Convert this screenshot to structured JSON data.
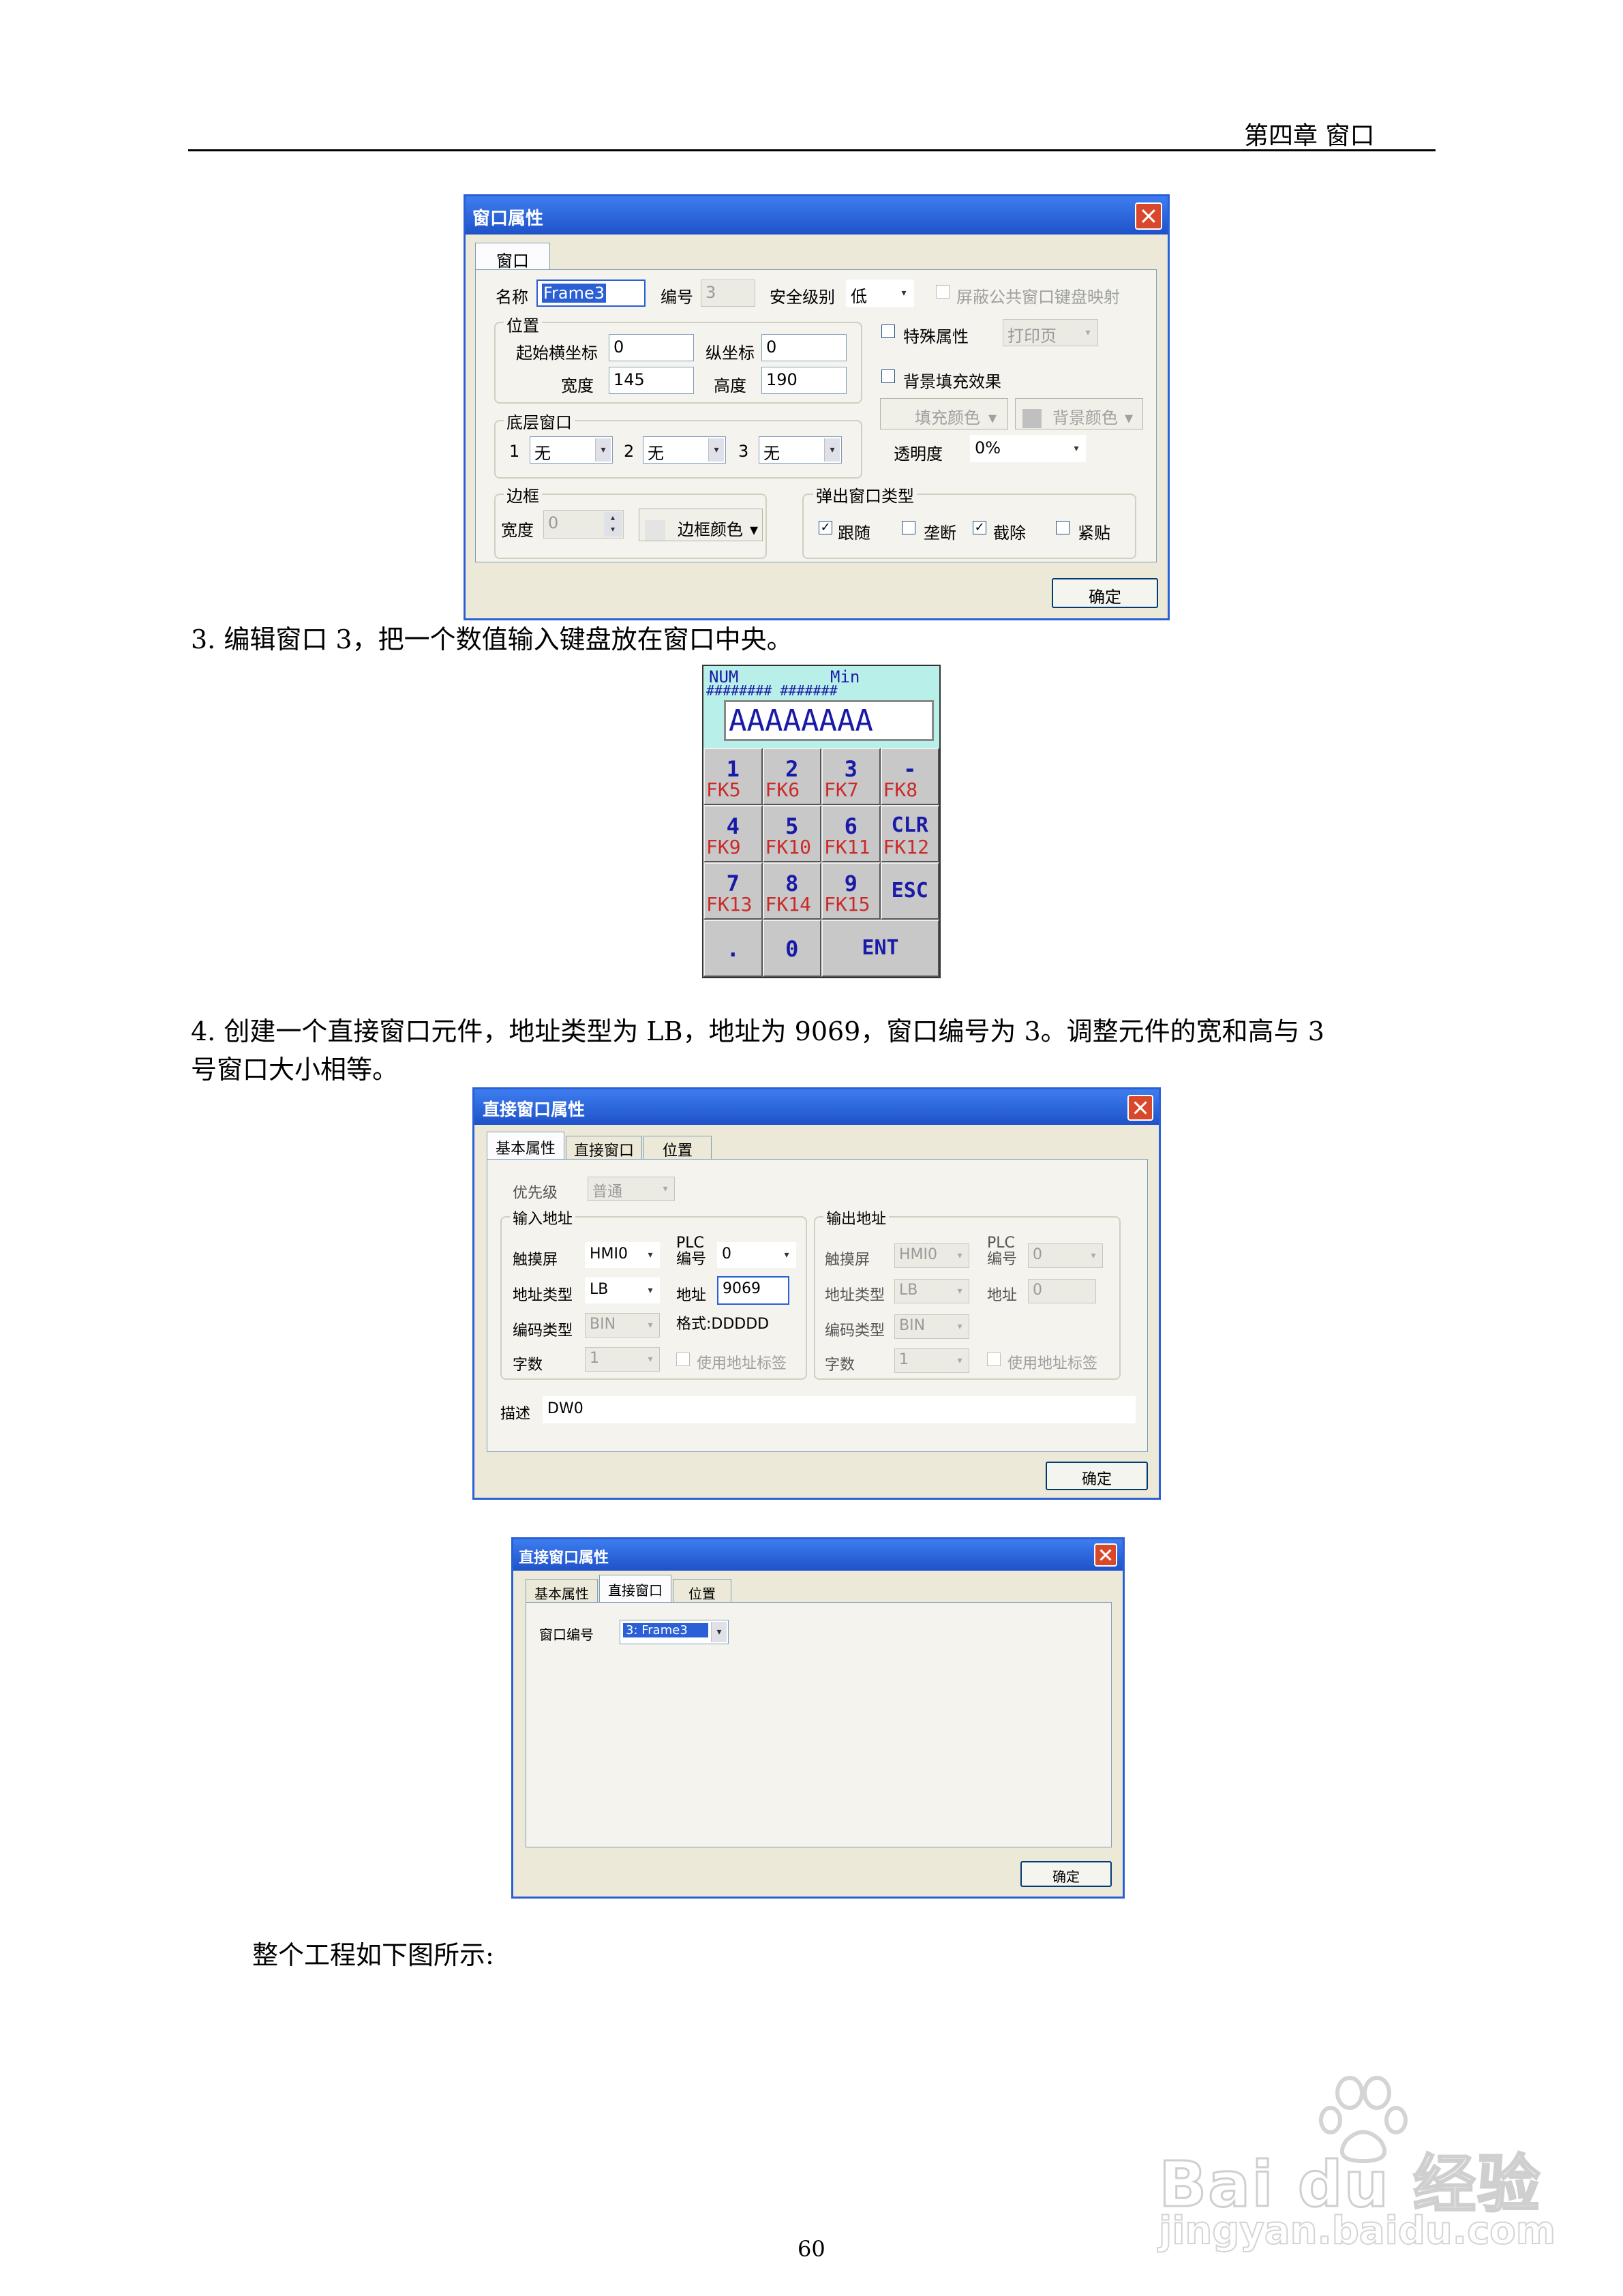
{
  "header": {
    "chapter": "第四章  窗口"
  },
  "dialog1": {
    "title": "窗口属性",
    "tab": "窗口",
    "name_label": "名称",
    "name_value": "Frame3",
    "number_label": "编号",
    "number_value": "3",
    "security_label": "安全级别",
    "security_value": "低",
    "mask_keyboard_label": "屏蔽公共窗口键盘映射",
    "position_group": "位置",
    "start_x_label": "起始横坐标",
    "start_x_value": "0",
    "start_y_label": "纵坐标",
    "start_y_value": "0",
    "width_label": "宽度",
    "width_value": "145",
    "height_label": "高度",
    "height_value": "190",
    "special_label": "特殊属性",
    "print_page": "打印页",
    "bg_fill_label": "背景填充效果",
    "fill_color": "填充颜色",
    "bg_color": "背景颜色",
    "base_window_group": "底层窗口",
    "base1_label": "1",
    "base1_value": "无",
    "base2_label": "2",
    "base2_value": "无",
    "base3_label": "3",
    "base3_value": "无",
    "transparency_label": "透明度",
    "transparency_value": "0%",
    "border_group": "边框",
    "border_width_label": "宽度",
    "border_width_value": "0",
    "border_color": "边框颜色",
    "popup_group": "弹出窗口类型",
    "popup_follow": "跟随",
    "popup_block": "垄断",
    "popup_clear": "截除",
    "popup_stick": "紧贴",
    "ok": "确定"
  },
  "step3": "3. 编辑窗口 3，把一个数值输入键盘放在窗口中央。",
  "keypad": {
    "display_top_left": "NUM",
    "display_top_right": "Min",
    "display_hash": "########  #######",
    "display_value": "AAAAAAAA",
    "keys": [
      {
        "main": "1",
        "fk": "FK5"
      },
      {
        "main": "2",
        "fk": "FK6"
      },
      {
        "main": "3",
        "fk": "FK7"
      },
      {
        "main": "-",
        "fk": "FK8"
      },
      {
        "main": "4",
        "fk": "FK9"
      },
      {
        "main": "5",
        "fk": "FK10"
      },
      {
        "main": "6",
        "fk": "FK11"
      },
      {
        "main": "CLR",
        "fk": "FK12"
      },
      {
        "main": "7",
        "fk": "FK13"
      },
      {
        "main": "8",
        "fk": "FK14"
      },
      {
        "main": "9",
        "fk": "FK15"
      },
      {
        "main": "ESC",
        "fk": ""
      },
      {
        "main": ".",
        "fk": ""
      },
      {
        "main": "0",
        "fk": ""
      },
      {
        "main": "ENT",
        "fk": ""
      }
    ]
  },
  "step4_line1": "4. 创建一个直接窗口元件，地址类型为 LB，地址为 9069，窗口编号为 3。调整元件的宽和高与 3",
  "step4_line2": "号窗口大小相等。",
  "dialog2": {
    "title": "直接窗口属性",
    "tab_basic": "基本属性",
    "tab_direct": "直接窗口",
    "tab_position": "位置",
    "priority_label": "优先级",
    "priority_value": "普通",
    "input_group": "输入地址",
    "output_group": "输出地址",
    "touch_label": "触摸屏",
    "touch_value": "HMI0",
    "plc_label_1": "PLC",
    "plc_label_2": "编号",
    "plc_value": "0",
    "addr_type_label": "地址类型",
    "addr_type_value": "LB",
    "addr_label": "地址",
    "addr_value": "9069",
    "code_type_label": "编码类型",
    "code_type_value": "BIN",
    "format_label": "格式:DDDDD",
    "word_count_label": "字数",
    "word_count_value": "1",
    "use_tag_label": "使用地址标签",
    "out_touch_value": "HMI0",
    "out_plc_value": "0",
    "out_addr_type_value": "LB",
    "out_addr_value": "0",
    "out_code_type_value": "BIN",
    "out_word_count_value": "1",
    "desc_label": "描述",
    "desc_value": "DW0",
    "ok": "确定"
  },
  "dialog3": {
    "title": "直接窗口属性",
    "tab_basic": "基本属性",
    "tab_direct": "直接窗口",
    "tab_position": "位置",
    "window_no_label": "窗口编号",
    "window_no_value": "3: Frame3",
    "ok": "确定"
  },
  "closing_text": "整个工程如下图所示:",
  "page_number": "60",
  "watermark": {
    "brand": "Bai du 经验",
    "url": "jingyan.baidu.com"
  }
}
